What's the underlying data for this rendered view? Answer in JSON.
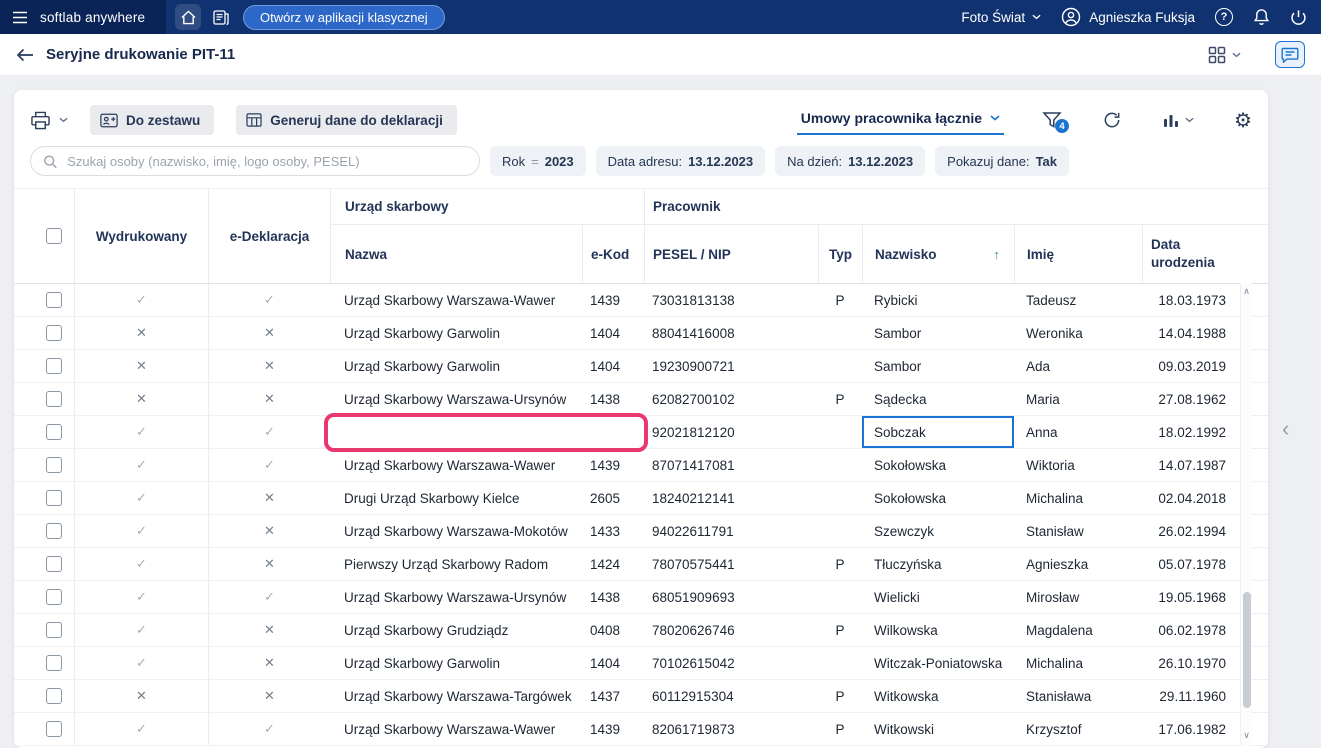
{
  "colors": {
    "accent": "#1b74d3",
    "topbar": "#113271",
    "annotation_highlight": "#e8386e",
    "sort_arrow": "#2f9e63"
  },
  "topbar": {
    "brand": "softlab anywhere",
    "open_classic_label": "Otwórz w aplikacji klasycznej",
    "company": "Foto Świat",
    "user": "Agnieszka Fuksja"
  },
  "titlebar": {
    "title": "Seryjne drukowanie PIT-11"
  },
  "toolbar": {
    "do_zestawu_label": "Do zestawu",
    "generuj_label": "Generuj dane do deklaracji",
    "umowy_label": "Umowy pracownika łącznie",
    "filter_badge": "4"
  },
  "filters": {
    "search_placeholder": "Szukaj osoby (nazwisko, imię, logo osoby, PESEL)",
    "chips": [
      {
        "label": "Rok",
        "op": "=",
        "value": "2023"
      },
      {
        "label": "Data adresu:",
        "value": "13.12.2023"
      },
      {
        "label": "Na dzień:",
        "value": "13.12.2023"
      },
      {
        "label": "Pokazuj dane:",
        "value": "Tak"
      }
    ]
  },
  "icons": {
    "sort_asc": "↑",
    "scroll_up": "∧",
    "scroll_down": "∨",
    "collapse_panel": "‹"
  },
  "table": {
    "group_headers": {
      "urzad": "Urząd skarbowy",
      "pracownik": "Pracownik"
    },
    "headers": {
      "wydrukowany": "Wydrukowany",
      "edeklaracja": "e-Deklaracja",
      "nazwa": "Nazwa",
      "ekod": "e-Kod",
      "pesel": "PESEL / NIP",
      "typ": "Typ",
      "nazwisko": "Nazwisko",
      "imie": "Imię",
      "data_urodzenia": "Data urodzenia"
    },
    "rows": [
      {
        "wydrukowany": "✓",
        "edeklaracja": "✓",
        "nazwa": "Urząd Skarbowy Warszawa-Wawer",
        "ekod": "1439",
        "pesel": "73031813138",
        "typ": "P",
        "nazwisko": "Rybicki",
        "imie": "Tadeusz",
        "data_urodzenia": "18.03.1973"
      },
      {
        "wydrukowany": "✕",
        "edeklaracja": "✕",
        "nazwa": "Urząd Skarbowy Garwolin",
        "ekod": "1404",
        "pesel": "88041416008",
        "typ": "",
        "nazwisko": "Sambor",
        "imie": "Weronika",
        "data_urodzenia": "14.04.1988"
      },
      {
        "wydrukowany": "✕",
        "edeklaracja": "✕",
        "nazwa": "Urząd Skarbowy Garwolin",
        "ekod": "1404",
        "pesel": "19230900721",
        "typ": "",
        "nazwisko": "Sambor",
        "imie": "Ada",
        "data_urodzenia": "09.03.2019"
      },
      {
        "wydrukowany": "✕",
        "edeklaracja": "✕",
        "nazwa": "Urząd Skarbowy Warszawa-Ursynów",
        "ekod": "1438",
        "pesel": "62082700102",
        "typ": "P",
        "nazwisko": "Sądecka",
        "imie": "Maria",
        "data_urodzenia": "27.08.1962"
      },
      {
        "wydrukowany": "✓",
        "edeklaracja": "✓",
        "nazwa": "",
        "ekod": "",
        "pesel": "92021812120",
        "typ": "",
        "nazwisko": "Sobczak",
        "imie": "Anna",
        "data_urodzenia": "18.02.1992",
        "highlighted": true,
        "selected": "nazwisko"
      },
      {
        "wydrukowany": "✓",
        "edeklaracja": "✓",
        "nazwa": "Urząd Skarbowy Warszawa-Wawer",
        "ekod": "1439",
        "pesel": "87071417081",
        "typ": "",
        "nazwisko": "Sokołowska",
        "imie": "Wiktoria",
        "data_urodzenia": "14.07.1987"
      },
      {
        "wydrukowany": "✓",
        "edeklaracja": "✕",
        "nazwa": "Drugi Urząd Skarbowy Kielce",
        "ekod": "2605",
        "pesel": "18240212141",
        "typ": "",
        "nazwisko": "Sokołowska",
        "imie": "Michalina",
        "data_urodzenia": "02.04.2018"
      },
      {
        "wydrukowany": "✓",
        "edeklaracja": "✕",
        "nazwa": "Urząd Skarbowy Warszawa-Mokotów",
        "ekod": "1433",
        "pesel": "94022611791",
        "typ": "",
        "nazwisko": "Szewczyk",
        "imie": "Stanisław",
        "data_urodzenia": "26.02.1994"
      },
      {
        "wydrukowany": "✓",
        "edeklaracja": "✕",
        "nazwa": "Pierwszy Urząd Skarbowy Radom",
        "ekod": "1424",
        "pesel": "78070575441",
        "typ": "P",
        "nazwisko": "Tłuczyńska",
        "imie": "Agnieszka",
        "data_urodzenia": "05.07.1978"
      },
      {
        "wydrukowany": "✓",
        "edeklaracja": "✓",
        "nazwa": "Urząd Skarbowy Warszawa-Ursynów",
        "ekod": "1438",
        "pesel": "68051909693",
        "typ": "",
        "nazwisko": "Wielicki",
        "imie": "Mirosław",
        "data_urodzenia": "19.05.1968"
      },
      {
        "wydrukowany": "✓",
        "edeklaracja": "✕",
        "nazwa": "Urząd Skarbowy Grudziądz",
        "ekod": "0408",
        "pesel": "78020626746",
        "typ": "P",
        "nazwisko": "Wilkowska",
        "imie": "Magdalena",
        "data_urodzenia": "06.02.1978"
      },
      {
        "wydrukowany": "✓",
        "edeklaracja": "✕",
        "nazwa": "Urząd Skarbowy Garwolin",
        "ekod": "1404",
        "pesel": "70102615042",
        "typ": "",
        "nazwisko": "Witczak-Poniatowska",
        "imie": "Michalina",
        "data_urodzenia": "26.10.1970"
      },
      {
        "wydrukowany": "✕",
        "edeklaracja": "✕",
        "nazwa": "Urząd Skarbowy Warszawa-Targówek",
        "ekod": "1437",
        "pesel": "60112915304",
        "typ": "P",
        "nazwisko": "Witkowska",
        "imie": "Stanisława",
        "data_urodzenia": "29.11.1960"
      },
      {
        "wydrukowany": "✓",
        "edeklaracja": "✓",
        "nazwa": "Urząd Skarbowy Warszawa-Wawer",
        "ekod": "1439",
        "pesel": "82061719873",
        "typ": "P",
        "nazwisko": "Witkowski",
        "imie": "Krzysztof",
        "data_urodzenia": "17.06.1982"
      }
    ]
  }
}
